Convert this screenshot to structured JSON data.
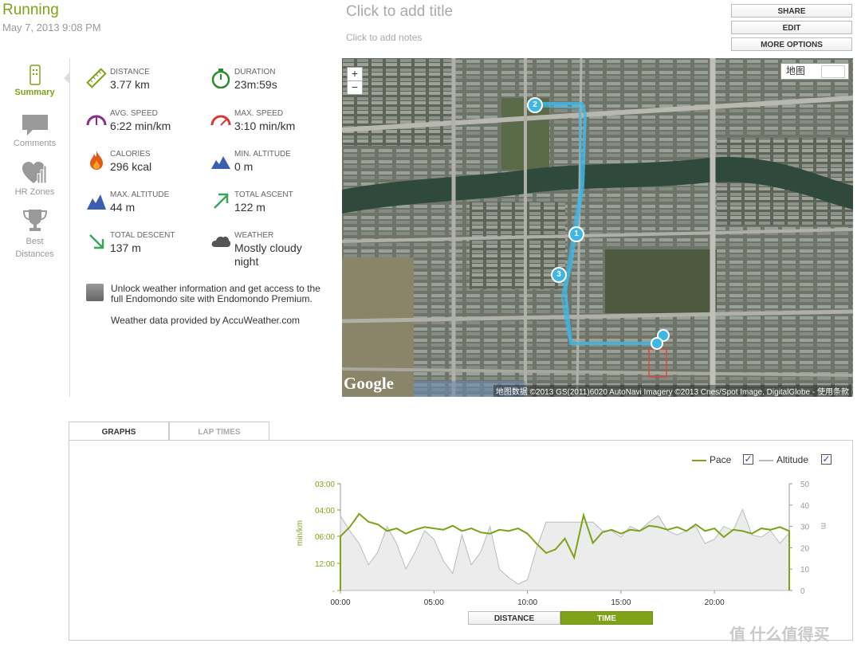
{
  "header": {
    "activity": "Running",
    "date": "May 7, 2013 9:08 PM",
    "title_placeholder": "Click to add title",
    "notes_placeholder": "Click to add notes"
  },
  "buttons": {
    "share": "SHARE",
    "edit": "EDIT",
    "more": "MORE OPTIONS"
  },
  "sidenav": [
    {
      "label": "Summary",
      "icon": "running-shoe-icon",
      "active": true
    },
    {
      "label": "Comments",
      "icon": "comment-icon",
      "active": false
    },
    {
      "label": "HR Zones",
      "icon": "heart-chart-icon",
      "active": false
    },
    {
      "label": "Best Distances",
      "icon": "trophy-icon",
      "active": false
    }
  ],
  "stats": {
    "distance": {
      "label": "DISTANCE",
      "value": "3.77 km",
      "icon": "ruler-icon"
    },
    "duration": {
      "label": "DURATION",
      "value": "23m:59s",
      "icon": "stopwatch-icon"
    },
    "avg_speed": {
      "label": "AVG. SPEED",
      "value": "6:22 min/km",
      "icon": "gauge-icon"
    },
    "max_speed": {
      "label": "MAX. SPEED",
      "value": "3:10 min/km",
      "icon": "gauge-max-icon"
    },
    "calories": {
      "label": "CALORIES",
      "value": "296 kcal",
      "icon": "flame-icon"
    },
    "min_altitude": {
      "label": "MIN. ALTITUDE",
      "value": "0 m",
      "icon": "mountain-low-icon"
    },
    "max_altitude": {
      "label": "MAX. ALTITUDE",
      "value": "44 m",
      "icon": "mountain-icon"
    },
    "total_ascent": {
      "label": "TOTAL ASCENT",
      "value": "122 m",
      "icon": "arrow-up-right-icon"
    },
    "total_descent": {
      "label": "TOTAL DESCENT",
      "value": "137 m",
      "icon": "arrow-down-right-icon"
    },
    "weather": {
      "label": "WEATHER",
      "value_line1": "Mostly cloudy",
      "value_line2": "night",
      "icon": "cloud-icon"
    }
  },
  "unlock": {
    "text": "Unlock weather information and get access to the full Endomondo site with Endomondo Premium.",
    "source": "Weather data provided by AccuWeather.com"
  },
  "map": {
    "zoom_in": "+",
    "zoom_out": "−",
    "map_type": "地图",
    "logo": "Google",
    "copyright": "地图数据 ©2013 GS(2011)6020 AutoNavi Imagery ©2013 Cnes/Spot Image, DigitalGlobe - 使用条款",
    "markers": [
      "1",
      "2",
      "3"
    ]
  },
  "tabs": {
    "graphs": "GRAPHS",
    "lap_times": "LAP TIMES"
  },
  "legend": {
    "pace": "Pace",
    "altitude": "Altitude",
    "check": "✓"
  },
  "xmode": {
    "distance": "DISTANCE",
    "time": "TIME"
  },
  "watermark": "值 什么值得买",
  "colors": {
    "accent": "#7ea218",
    "route": "#3fb7e5",
    "altitude_line": "#bbbbbb"
  },
  "chart_data": {
    "type": "line",
    "x": [
      0,
      0.5,
      1,
      1.5,
      2,
      2.5,
      3,
      3.5,
      4,
      4.5,
      5,
      5.5,
      6,
      6.5,
      7,
      7.5,
      8,
      8.5,
      9,
      9.5,
      10,
      10.5,
      11,
      11.5,
      12,
      12.5,
      13,
      13.5,
      14,
      14.5,
      15,
      15.5,
      16,
      16.5,
      17,
      17.5,
      18,
      18.5,
      19,
      19.5,
      20,
      20.5,
      21,
      21.5,
      22,
      22.5,
      23,
      23.5,
      24
    ],
    "x_tick_labels": [
      "00:00",
      "05:00",
      "10:00",
      "15:00",
      "20:00"
    ],
    "x_ticks": [
      0,
      5,
      10,
      15,
      20
    ],
    "xlim": [
      0,
      24
    ],
    "series": [
      {
        "name": "Pace",
        "axis": "left",
        "values": [
          6.0,
          5.3,
          4.3,
          4.9,
          5.1,
          5.6,
          5.4,
          5.8,
          5.5,
          5.3,
          5.4,
          5.5,
          5.2,
          5.6,
          5.4,
          5.7,
          5.8,
          5.5,
          5.6,
          5.4,
          5.8,
          7.7,
          9.7,
          8.9,
          6.5,
          10.7,
          4.4,
          7.5,
          5.7,
          5.5,
          5.8,
          5.5,
          5.6,
          5.2,
          5.3,
          5.5,
          5.3,
          5.6,
          5.1,
          5.6,
          5.4,
          6.2,
          5.5,
          5.6,
          5.8,
          5.4,
          5.5,
          5.3,
          5.6
        ]
      },
      {
        "name": "Altitude",
        "axis": "right",
        "values": [
          35,
          28,
          22,
          12,
          18,
          30,
          22,
          10,
          18,
          28,
          24,
          14,
          8,
          26,
          12,
          18,
          30,
          10,
          6,
          3,
          5,
          20,
          32,
          32,
          32,
          32,
          32,
          32,
          28,
          28,
          25,
          30,
          28,
          32,
          35,
          28,
          26,
          28,
          30,
          22,
          24,
          30,
          28,
          38,
          26,
          25,
          28,
          22,
          27
        ]
      }
    ],
    "left_axis": {
      "label": "min/km",
      "tick_labels": [
        "03:00",
        "04:00",
        "06:00",
        "12:00",
        "-"
      ]
    },
    "right_axis": {
      "label": "m",
      "tick_labels": [
        "50",
        "40",
        "30",
        "20",
        "10",
        "0"
      ],
      "ylim": [
        0,
        50
      ]
    },
    "legend_position": "top-right"
  }
}
